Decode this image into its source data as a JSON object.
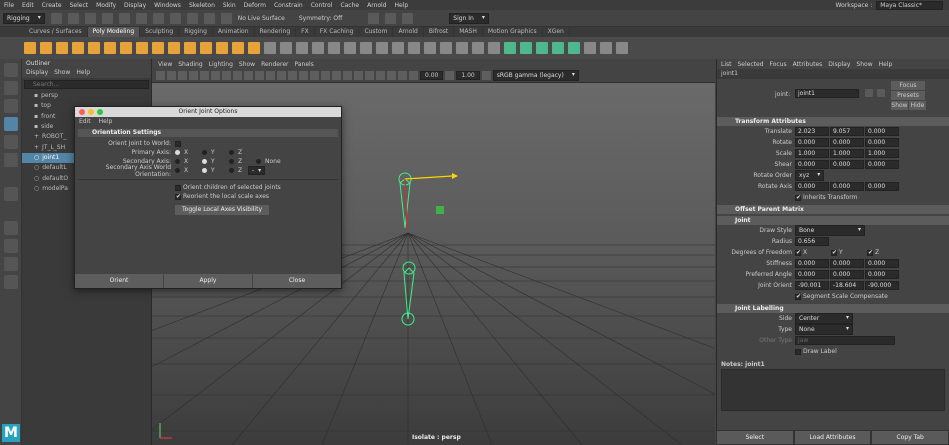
{
  "menubar": {
    "items": [
      "File",
      "Edit",
      "Create",
      "Select",
      "Modify",
      "Display",
      "Windows",
      "Skeleton",
      "Skin",
      "Deform",
      "Constrain",
      "Control",
      "Cache",
      "Arnold",
      "Help"
    ],
    "workspace_label": "Workspace :",
    "workspace_value": "Maya Classic*"
  },
  "statusline": {
    "mode": "Rigging",
    "live_surface": "No Live Surface",
    "symmetry": "Symmetry: Off",
    "sign_in": "Sign In"
  },
  "shelf": {
    "tabs": [
      "Curves / Surfaces",
      "Poly Modeling",
      "Sculpting",
      "Rigging",
      "Animation",
      "Rendering",
      "FX",
      "FX Caching",
      "Custom",
      "Arnold",
      "Bifrost",
      "MASH",
      "Motion Graphics",
      "XGen"
    ],
    "active_tab": "Poly Modeling"
  },
  "outliner": {
    "title": "Outliner",
    "menu": [
      "Display",
      "Show",
      "Help"
    ],
    "search_placeholder": "Search...",
    "items": [
      "persp",
      "top",
      "front",
      "side",
      "ROBOT_",
      "JT_L_SH",
      "joint1",
      "defaultL",
      "defaultO",
      "modelPa"
    ],
    "selected": "joint1"
  },
  "viewport": {
    "menu": [
      "View",
      "Shading",
      "Lighting",
      "Show",
      "Renderer",
      "Panels"
    ],
    "field1": "0.00",
    "field2": "1.00",
    "colorspace": "sRGB gamma (legacy)",
    "hud": "Isolate : persp"
  },
  "attribute_editor": {
    "menu": [
      "List",
      "Selected",
      "Focus",
      "Attributes",
      "Display",
      "Show",
      "Help"
    ],
    "tab": "joint1",
    "node_label": "joint:",
    "node_value": "joint1",
    "focus_btn": "Focus",
    "presets_btn": "Presets",
    "show_btn": "Show",
    "hide_btn": "Hide",
    "transform_header": "Transform Attributes",
    "translate": [
      "2.023",
      "9.057",
      "0.000"
    ],
    "rotate": [
      "0.000",
      "0.000",
      "0.000"
    ],
    "scale": [
      "1.000",
      "1.000",
      "1.000"
    ],
    "shear": [
      "0.000",
      "0.000",
      "0.000"
    ],
    "rotate_order": "xyz",
    "rotate_axis": [
      "0.000",
      "0.000",
      "0.000"
    ],
    "inherits_transform": "Inherits Transform",
    "offset_header": "Offset Parent Matrix",
    "joint_header": "Joint",
    "draw_style": "Bone",
    "radius": "0.656",
    "dof_x": "X",
    "dof_y": "Y",
    "dof_z": "Z",
    "stiffness": [
      "0.000",
      "0.000",
      "0.000"
    ],
    "preferred_angle": [
      "0.000",
      "0.000",
      "0.000"
    ],
    "joint_orient": [
      "-90.001",
      "-18.604",
      "-90.000"
    ],
    "segment_scale": "Segment Scale Compensate",
    "labelling_header": "Joint Labelling",
    "side": "Center",
    "type": "None",
    "other_type": "jaw",
    "draw_label": "Draw Label",
    "labels": {
      "translate": "Translate",
      "rotate": "Rotate",
      "scale": "Scale",
      "shear": "Shear",
      "rotate_order": "Rotate Order",
      "rotate_axis": "Rotate Axis",
      "draw_style": "Draw Style",
      "radius": "Radius",
      "dof": "Degrees of Freedom",
      "stiffness": "Stiffness",
      "preferred": "Preferred Angle",
      "orient": "Joint Orient",
      "side": "Side",
      "type": "Type",
      "other": "Other Type"
    },
    "notes": "Notes:  joint1",
    "select_btn": "Select",
    "load_btn": "Load Attributes",
    "copy_btn": "Copy Tab"
  },
  "dialog": {
    "title": "Orient Joint Options",
    "menu": [
      "Edit",
      "Help"
    ],
    "section": "Orientation Settings",
    "orient_world": "Orient Joint to World:",
    "primary": "Primary Axis:",
    "secondary": "Secondary Axis:",
    "secondary_world": "Secondary Axis World Orientation:",
    "x": "X",
    "y": "Y",
    "z": "Z",
    "none": "None",
    "minus": "-",
    "orient_children": "Orient children of selected joints",
    "reorient": "Reorient the local scale axes",
    "toggle_btn": "Toggle Local Axes Visibility",
    "orient_btn": "Orient",
    "apply_btn": "Apply",
    "close_btn": "Close"
  }
}
